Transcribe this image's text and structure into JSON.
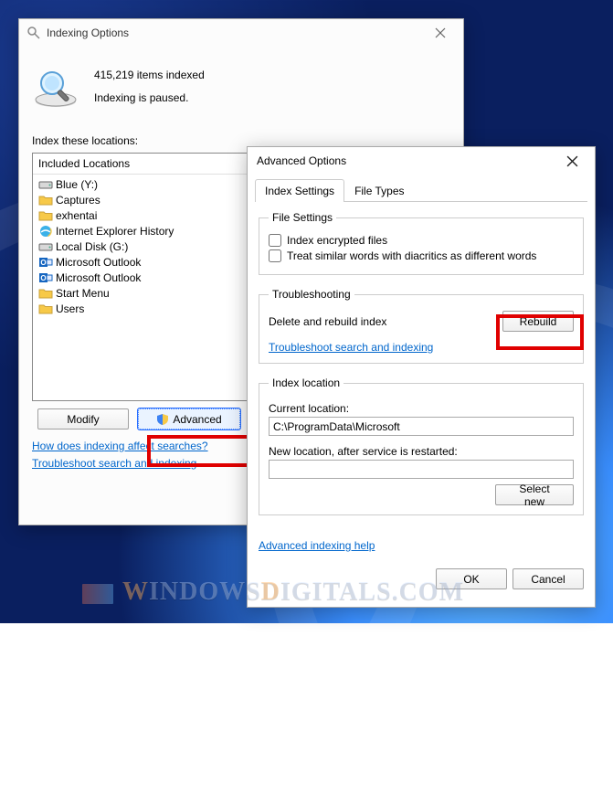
{
  "indexing": {
    "title": "Indexing Options",
    "items_indexed": "415,219 items indexed",
    "status": "Indexing is paused.",
    "section_label": "Index these locations:",
    "header": "Included Locations",
    "locations": [
      {
        "icon": "drive",
        "label": "Blue (Y:)"
      },
      {
        "icon": "folder",
        "label": "Captures"
      },
      {
        "icon": "folder",
        "label": "exhentai"
      },
      {
        "icon": "ie",
        "label": "Internet Explorer History"
      },
      {
        "icon": "drive",
        "label": "Local Disk (G:)"
      },
      {
        "icon": "outlook",
        "label": "Microsoft Outlook"
      },
      {
        "icon": "outlook",
        "label": "Microsoft Outlook"
      },
      {
        "icon": "folder",
        "label": "Start Menu"
      },
      {
        "icon": "folder",
        "label": "Users"
      }
    ],
    "modify_btn": "Modify",
    "advanced_btn": "Advanced",
    "link1": "How does indexing affect searches?",
    "link2": "Troubleshoot search and indexing"
  },
  "advanced": {
    "title": "Advanced Options",
    "tab1": "Index Settings",
    "tab2": "File Types",
    "fs_legend": "File Settings",
    "chk1": "Index encrypted files",
    "chk2": "Treat similar words with diacritics as different words",
    "tr_legend": "Troubleshooting",
    "tr_text": "Delete and rebuild index",
    "rebuild_btn": "Rebuild",
    "tr_link": "Troubleshoot search and indexing",
    "il_legend": "Index location",
    "cur_label": "Current location:",
    "cur_value": "C:\\ProgramData\\Microsoft",
    "new_label": "New location, after service is restarted:",
    "new_value": "",
    "select_new_btn": "Select new",
    "help_link": "Advanced indexing help",
    "ok_btn": "OK",
    "cancel_btn": "Cancel"
  },
  "watermark": {
    "brand1": "W",
    "brand2": "INDOWS",
    "brand3": "D",
    "brand4": "IGITALS.COM"
  }
}
